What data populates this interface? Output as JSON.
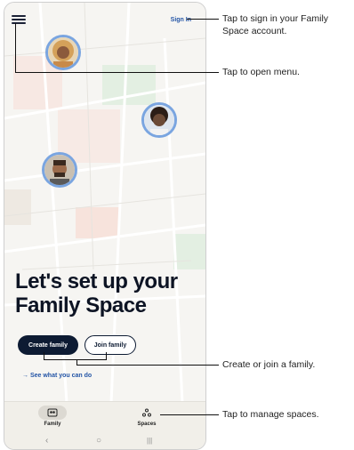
{
  "topbar": {
    "menu_icon": "menu-icon",
    "signin_label": "Sign In"
  },
  "main": {
    "headline": "Let's set up your Family Space",
    "create_label": "Create family",
    "join_label": "Join family",
    "see_label": "→ See what you can do"
  },
  "bottom_nav": {
    "family_label": "Family",
    "spaces_label": "Spaces",
    "family_icon": "family-icon",
    "spaces_icon": "spaces-icon"
  },
  "system_nav": {
    "back": "‹",
    "home": "○",
    "recents": "|||"
  },
  "callouts": {
    "signin": "Tap to sign in your Family Space account.",
    "menu": "Tap to open menu.",
    "create_join": "Create or join a family.",
    "spaces": "Tap to manage spaces."
  },
  "colors": {
    "accent": "#2455a6",
    "dark": "#0d1b33",
    "avatar_ring": "#7aa5e0"
  }
}
